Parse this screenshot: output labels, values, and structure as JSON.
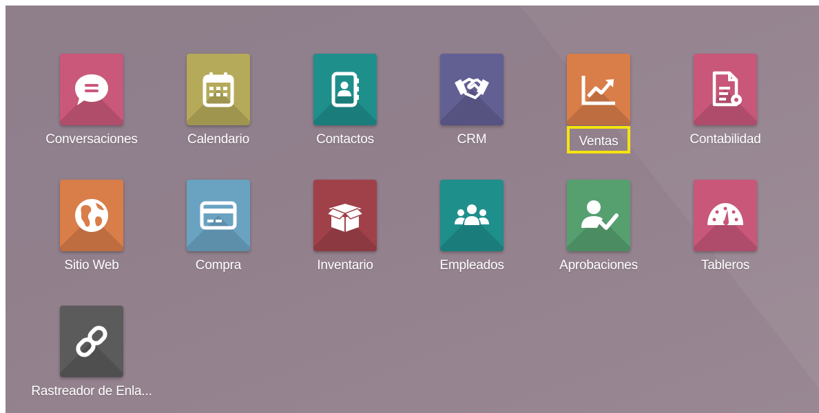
{
  "apps": [
    {
      "key": "conversaciones",
      "label": "Conversaciones",
      "icon": "chat-bubble-icon",
      "color": "#c9587a"
    },
    {
      "key": "calendario",
      "label": "Calendario",
      "icon": "calendar-icon",
      "color": "#b5aa5a"
    },
    {
      "key": "contactos",
      "label": "Contactos",
      "icon": "address-book-icon",
      "color": "#1f8f8c"
    },
    {
      "key": "crm",
      "label": "CRM",
      "icon": "handshake-icon",
      "color": "#625f93"
    },
    {
      "key": "ventas",
      "label": "Ventas",
      "icon": "line-chart-icon",
      "color": "#d97d49",
      "highlighted": true,
      "highlight_color": "#f5e30e"
    },
    {
      "key": "contabilidad",
      "label": "Contabilidad",
      "icon": "invoice-gear-icon",
      "color": "#c8577a"
    },
    {
      "key": "sitio_web",
      "label": "Sitio Web",
      "icon": "globe-icon",
      "color": "#d97d49"
    },
    {
      "key": "compra",
      "label": "Compra",
      "icon": "credit-card-icon",
      "color": "#6aa3c2"
    },
    {
      "key": "inventario",
      "label": "Inventario",
      "icon": "open-box-icon",
      "color": "#a0414a"
    },
    {
      "key": "empleados",
      "label": "Empleados",
      "icon": "people-group-icon",
      "color": "#1f8f8c"
    },
    {
      "key": "aprobaciones",
      "label": "Aprobaciones",
      "icon": "user-check-icon",
      "color": "#56a070"
    },
    {
      "key": "tableros",
      "label": "Tableros",
      "icon": "gauge-icon",
      "color": "#c8577a"
    },
    {
      "key": "rastreador",
      "label": "Rastreador de Enla...",
      "icon": "link-icon",
      "color": "#5b5b5b"
    }
  ]
}
